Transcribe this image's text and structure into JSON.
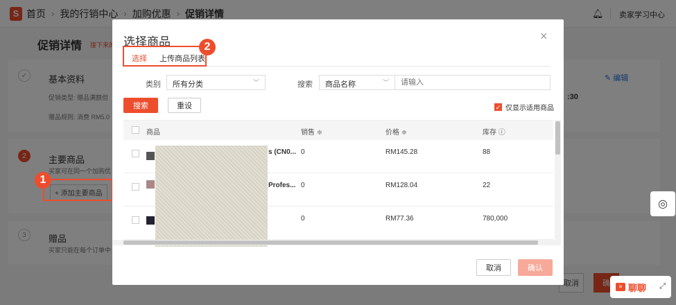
{
  "topbar": {
    "logo": "S",
    "breadcrumb": [
      "首页",
      "我的行销中心",
      "加购优惠",
      "促销详情"
    ],
    "bell_icon": "bell-icon",
    "user": "卖家学习中心"
  },
  "page": {
    "title": "促销详情",
    "hint": "接下来的",
    "basic": {
      "step": "✓",
      "title": "基本资料",
      "type_label": "促销类型: 赠品满额但",
      "rule_label": "赠品规则: 消费 RM5.0",
      "time_fragment": ":30",
      "edit": "编辑"
    },
    "main": {
      "step": "2",
      "title": "主要商品",
      "desc": "买家可在同一个加购优",
      "add_button": "+ 添加主要商品"
    },
    "gift": {
      "step": "3",
      "title": "赠品",
      "desc": "买家只能在每个订单中"
    },
    "bottom_cancel_fragment": "取消",
    "bottom_confirm_fragment": "确"
  },
  "callouts": {
    "one": "1",
    "two": "2"
  },
  "modal": {
    "title": "选择商品",
    "close": "×",
    "tabs": [
      "选择",
      "上传商品列表"
    ],
    "filter": {
      "category_label": "类别",
      "category_value": "所有分类",
      "search_label": "搜索",
      "search_field": "商品名称",
      "search_placeholder": "请输入"
    },
    "search_button": "搜索",
    "reset_button": "重设",
    "only_applicable": "仅显示适用商品",
    "table": {
      "headers": {
        "product": "商品",
        "sales": "销售 ≑",
        "price": "价格 ≑",
        "stock": "库存 ⓘ"
      },
      "rows": [
        {
          "name_fragment": "s (CN0...",
          "sales": "0",
          "price": "RM145.28",
          "stock": "88"
        },
        {
          "name_fragment": "Profes...",
          "sales": "0",
          "price": "RM128.04",
          "stock": "22"
        },
        {
          "name_fragment": "",
          "sales": "0",
          "price": "RM77.36",
          "stock": "780,000"
        }
      ]
    },
    "cancel": "取消",
    "confirm": "确认"
  },
  "float": {
    "support_icon": "support-icon"
  },
  "chat": {
    "label": "聊聊",
    "icon": "chat-icon",
    "expand_icon": "expand-icon"
  },
  "colors": {
    "brand": "#ee4d2d",
    "link": "#2673dd",
    "confirm_disabled": "#f7a99a"
  }
}
